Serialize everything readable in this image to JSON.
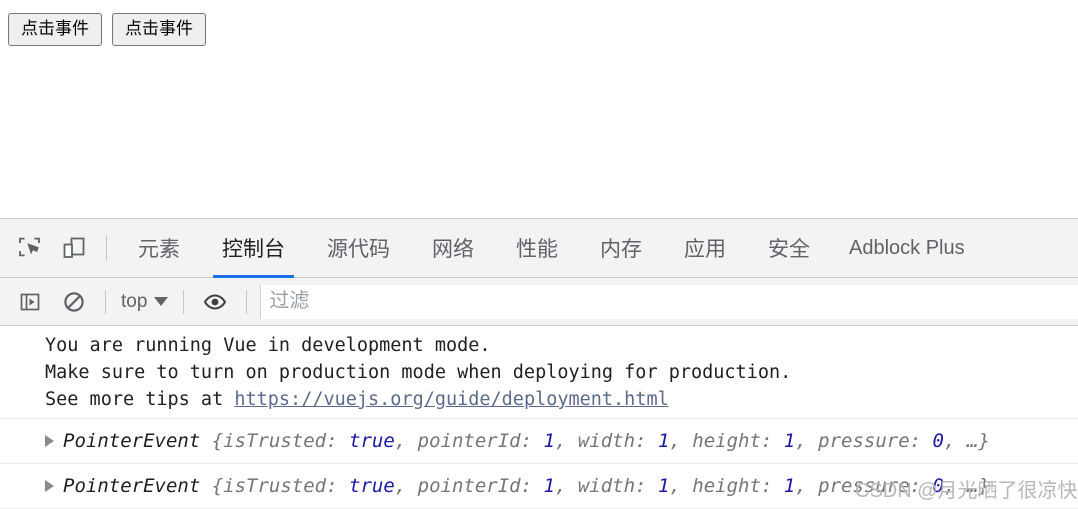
{
  "page": {
    "buttons": [
      {
        "label": "点击事件"
      },
      {
        "label": "点击事件"
      }
    ]
  },
  "devtools": {
    "toolbar_icons": [
      {
        "name": "inspect-element-icon"
      },
      {
        "name": "device-toolbar-icon"
      }
    ],
    "tabs": [
      {
        "label": "元素",
        "active": false
      },
      {
        "label": "控制台",
        "active": true
      },
      {
        "label": "源代码",
        "active": false
      },
      {
        "label": "网络",
        "active": false
      },
      {
        "label": "性能",
        "active": false
      },
      {
        "label": "内存",
        "active": false
      },
      {
        "label": "应用",
        "active": false
      },
      {
        "label": "安全",
        "active": false
      },
      {
        "label": "Adblock Plus",
        "active": false
      }
    ],
    "active_tab": "控制台",
    "accent_color": "#1a73e8",
    "console_toolbar": {
      "sidebar_toggle_icon": "show-console-sidebar-icon",
      "clear_icon": "clear-console-icon",
      "context": "top",
      "context_caret": "chevron-down-icon",
      "eye_icon": "live-expression-eye-icon",
      "filter_placeholder": "过滤",
      "filter_value": ""
    },
    "console": {
      "vue_warning": {
        "line1": "You are running Vue in development mode.",
        "line2": "Make sure to turn on production mode when deploying for production.",
        "line3_prefix": "See more tips at ",
        "line3_link": "https://vuejs.org/guide/deployment.html",
        "link_color": "#5b6b8c"
      },
      "events": [
        {
          "expander": "▶",
          "constructor": "PointerEvent",
          "open_brace": " {",
          "props": [
            {
              "key": "isTrusted: ",
              "value": "true"
            },
            {
              "key": "pointerId: ",
              "value": "1"
            },
            {
              "key": "width: ",
              "value": "1"
            },
            {
              "key": "height: ",
              "value": "1"
            },
            {
              "key": "pressure: ",
              "value": "0"
            }
          ],
          "ellipsis": " …}"
        },
        {
          "expander": "▶",
          "constructor": "PointerEvent",
          "open_brace": " {",
          "props": [
            {
              "key": "isTrusted: ",
              "value": "true"
            },
            {
              "key": "pointerId: ",
              "value": "1"
            },
            {
              "key": "width: ",
              "value": "1"
            },
            {
              "key": "height: ",
              "value": "1"
            },
            {
              "key": "pressure: ",
              "value": "0"
            }
          ],
          "ellipsis": " …}"
        }
      ]
    }
  },
  "watermark": {
    "text": "CSDN @月光晒了很凉快"
  }
}
